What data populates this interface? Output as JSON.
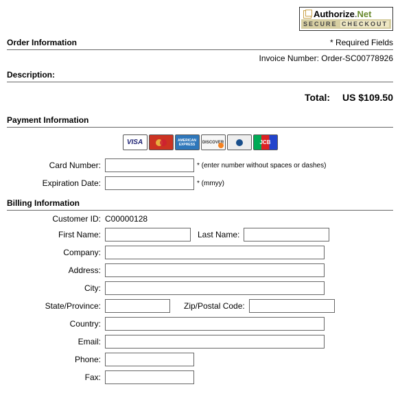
{
  "badge": {
    "brand_a": "Authorize",
    "brand_dot": ".",
    "brand_b": "Net",
    "secure": "SECURE",
    "checkout": "CHECKOUT"
  },
  "sections": {
    "order_info": "Order Information",
    "required": "* Required Fields",
    "invoice_label": "Invoice Number:",
    "invoice_value": "Order-SC00778926",
    "description": "Description:",
    "total_label": "Total:",
    "total_value": "US $109.50",
    "payment_info": "Payment Information",
    "billing_info": "Billing Information"
  },
  "payment": {
    "card_number_label": "Card Number:",
    "card_number_hint": "* (enter number without spaces or dashes)",
    "exp_label": "Expiration Date:",
    "exp_hint": "* (mmyy)"
  },
  "billing": {
    "customer_id_label": "Customer ID:",
    "customer_id_value": "C00000128",
    "first_name": "First Name:",
    "last_name": "Last Name:",
    "company": "Company:",
    "address": "Address:",
    "city": "City:",
    "state": "State/Province:",
    "zip": "Zip/Postal Code:",
    "country": "Country:",
    "email": "Email:",
    "phone": "Phone:",
    "fax": "Fax:"
  },
  "card_brands": {
    "visa": "VISA",
    "mc": "MasterCard",
    "amex": "AMERICAN EXPRESS",
    "disc": "DISCOVER",
    "dc": "Diners",
    "jcb": "JCB"
  }
}
